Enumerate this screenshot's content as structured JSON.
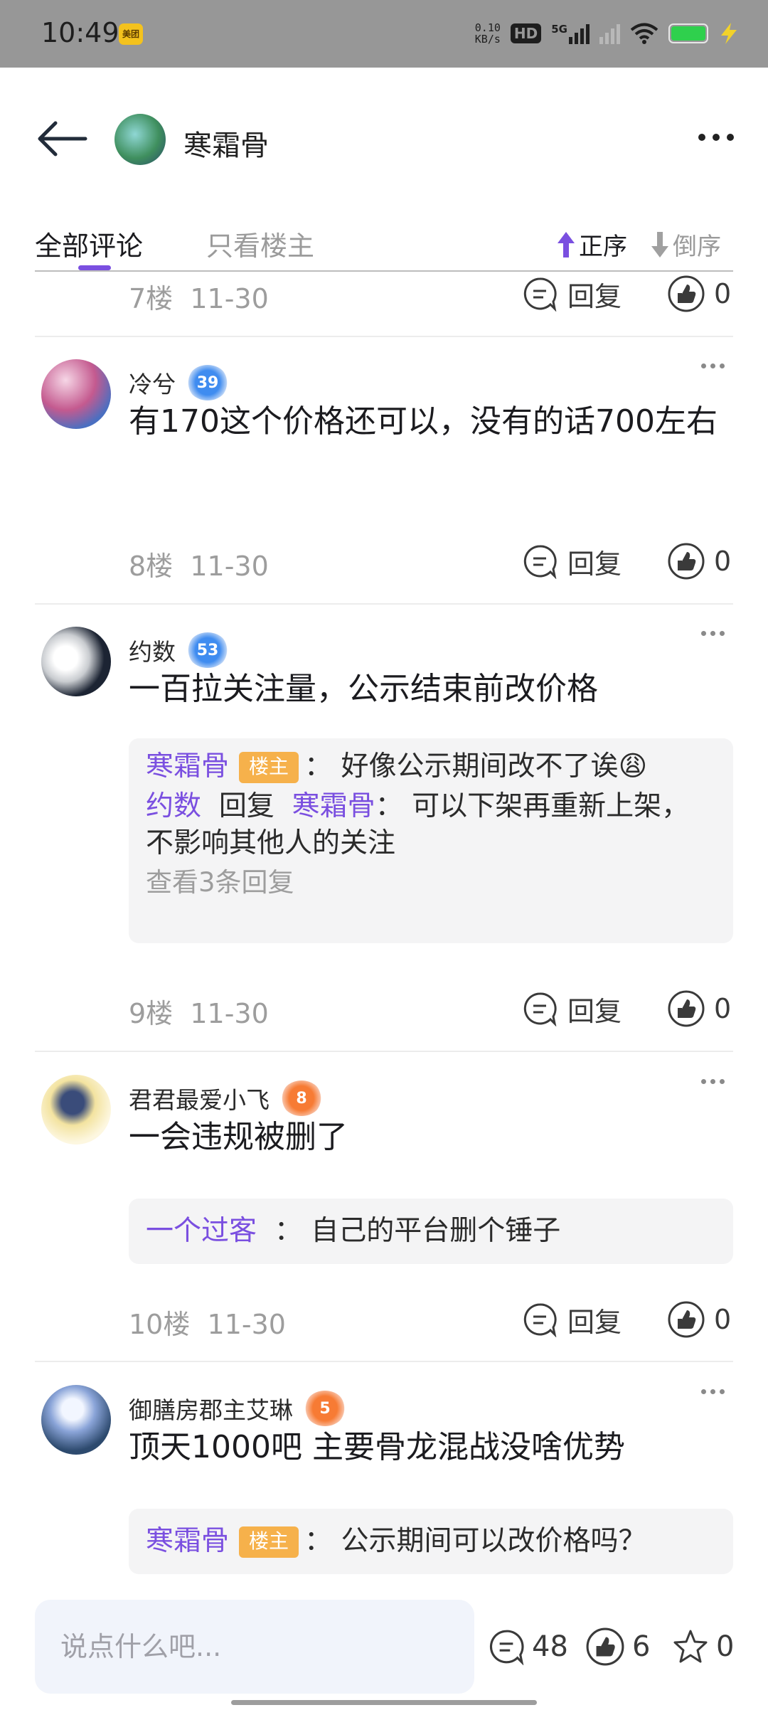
{
  "status_bar": {
    "time": "10:49",
    "app_badge": "美团",
    "net_speed_value": "0.10",
    "net_speed_unit": "KB/s",
    "hd": "HD",
    "network": "5G"
  },
  "header": {
    "author_name": "寒霜骨"
  },
  "tabs": {
    "all": "全部评论",
    "owner_only": "只看楼主",
    "sort_asc": "正序",
    "sort_desc": "倒序"
  },
  "colors": {
    "accent": "#7a4fe0",
    "owner_tag": "#f6b14b",
    "badge_blue": "#3f8cf0",
    "badge_orange": "#f77b34"
  },
  "top_partial": {
    "floor": "7楼",
    "date": "11-30",
    "reply_label": "回复",
    "likes": "0"
  },
  "comments": [
    {
      "username": "冷兮",
      "level": "39",
      "text": "有170这个价格还可以，没有的话700左右",
      "floor": "8楼",
      "date": "11-30",
      "reply_label": "回复",
      "likes": "0"
    },
    {
      "username": "约数",
      "level": "53",
      "text": "一百拉关注量，公示结束前改价格",
      "replies": [
        {
          "user": "寒霜骨",
          "tag": "楼主",
          "sep": "：",
          "text": "好像公示期间改不了诶😩"
        },
        {
          "user": "约数",
          "action": "回复",
          "target": "寒霜骨",
          "sep": "：",
          "text": "可以下架再重新上架，不影响其他人的关注"
        }
      ],
      "view_more": "查看3条回复",
      "floor": "9楼",
      "date": "11-30",
      "reply_label": "回复",
      "likes": "0"
    },
    {
      "username": "君君最爱小飞",
      "level": "8",
      "text": "一会违规被删了",
      "replies": [
        {
          "user": "一个过客",
          "sep": "：",
          "text": "自己的平台删个锤子"
        }
      ],
      "floor": "10楼",
      "date": "11-30",
      "reply_label": "回复",
      "likes": "0"
    },
    {
      "username": "御膳房郡主艾琳",
      "level": "5",
      "text": "顶天1000吧 主要骨龙混战没啥优势",
      "replies": [
        {
          "user": "寒霜骨",
          "tag": "楼主",
          "sep": "：",
          "text": "公示期间可以改价格吗？"
        }
      ]
    }
  ],
  "bottom_bar": {
    "input_placeholder": "说点什么吧...",
    "comments_count": "48",
    "likes_count": "6",
    "favorites_count": "0"
  }
}
